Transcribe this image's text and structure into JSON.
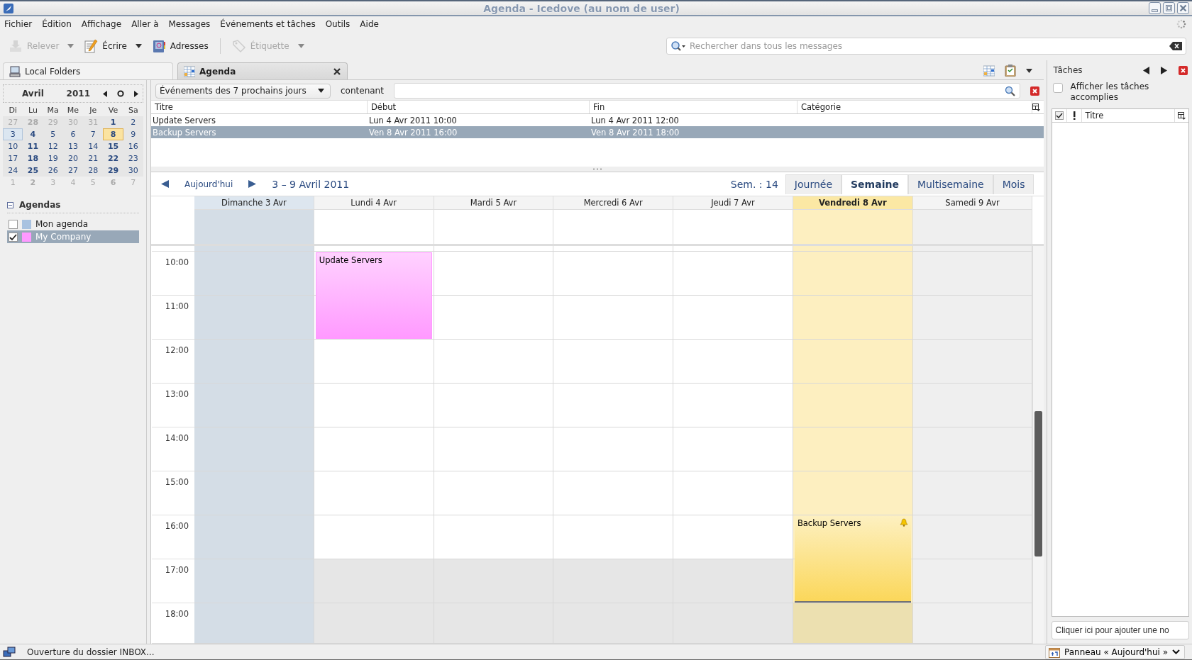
{
  "window": {
    "title": "Agenda - Icedove (au nom de user)"
  },
  "menu": [
    "Fichier",
    "Édition",
    "Affichage",
    "Aller à",
    "Messages",
    "Événements et tâches",
    "Outils",
    "Aide"
  ],
  "toolbar": {
    "buttons": [
      {
        "label": "Relever",
        "kind": "get",
        "disabled": true,
        "dropdown": true
      },
      {
        "label": "Écrire",
        "kind": "write",
        "disabled": false,
        "dropdown": true
      },
      {
        "label": "Adresses",
        "kind": "addressbook",
        "disabled": false,
        "dropdown": false
      },
      {
        "label": "Étiquette",
        "kind": "tag",
        "disabled": true,
        "dropdown": true
      }
    ],
    "search": {
      "placeholder": "Rechercher dans tous les messages"
    }
  },
  "tabs": [
    {
      "label": "Local Folders",
      "kind": "folders",
      "selected": false,
      "closable": false
    },
    {
      "label": "Agenda",
      "kind": "calendar",
      "selected": true,
      "closable": true
    }
  ],
  "minimonth": {
    "month": "Avril",
    "year": "2011",
    "weekdays": [
      "Di",
      "Lu",
      "Ma",
      "Me",
      "Je",
      "Ve",
      "Sa"
    ],
    "weeks": [
      [
        {
          "day": "27",
          "muted": true,
          "bold": false,
          "selected": false,
          "today": false
        },
        {
          "day": "28",
          "muted": true,
          "bold": true,
          "selected": false,
          "today": false
        },
        {
          "day": "29",
          "muted": true,
          "bold": false,
          "selected": false,
          "today": false
        },
        {
          "day": "30",
          "muted": true,
          "bold": false,
          "selected": false,
          "today": false
        },
        {
          "day": "31",
          "muted": true,
          "bold": false,
          "selected": false,
          "today": false
        },
        {
          "day": "1",
          "muted": false,
          "bold": true,
          "selected": false,
          "today": false
        },
        {
          "day": "2",
          "muted": false,
          "bold": false,
          "selected": false,
          "today": false
        }
      ],
      [
        {
          "day": "3",
          "muted": false,
          "bold": false,
          "selected": true,
          "today": false
        },
        {
          "day": "4",
          "muted": false,
          "bold": true,
          "selected": false,
          "today": false
        },
        {
          "day": "5",
          "muted": false,
          "bold": false,
          "selected": false,
          "today": false
        },
        {
          "day": "6",
          "muted": false,
          "bold": false,
          "selected": false,
          "today": false
        },
        {
          "day": "7",
          "muted": false,
          "bold": false,
          "selected": false,
          "today": false
        },
        {
          "day": "8",
          "muted": false,
          "bold": true,
          "selected": false,
          "today": true
        },
        {
          "day": "9",
          "muted": false,
          "bold": false,
          "selected": false,
          "today": false
        }
      ],
      [
        {
          "day": "10",
          "muted": false,
          "bold": false,
          "selected": false,
          "today": false
        },
        {
          "day": "11",
          "muted": false,
          "bold": true,
          "selected": false,
          "today": false
        },
        {
          "day": "12",
          "muted": false,
          "bold": false,
          "selected": false,
          "today": false
        },
        {
          "day": "13",
          "muted": false,
          "bold": false,
          "selected": false,
          "today": false
        },
        {
          "day": "14",
          "muted": false,
          "bold": false,
          "selected": false,
          "today": false
        },
        {
          "day": "15",
          "muted": false,
          "bold": true,
          "selected": false,
          "today": false
        },
        {
          "day": "16",
          "muted": false,
          "bold": false,
          "selected": false,
          "today": false
        }
      ],
      [
        {
          "day": "17",
          "muted": false,
          "bold": false,
          "selected": false,
          "today": false
        },
        {
          "day": "18",
          "muted": false,
          "bold": true,
          "selected": false,
          "today": false
        },
        {
          "day": "19",
          "muted": false,
          "bold": false,
          "selected": false,
          "today": false
        },
        {
          "day": "20",
          "muted": false,
          "bold": false,
          "selected": false,
          "today": false
        },
        {
          "day": "21",
          "muted": false,
          "bold": false,
          "selected": false,
          "today": false
        },
        {
          "day": "22",
          "muted": false,
          "bold": true,
          "selected": false,
          "today": false
        },
        {
          "day": "23",
          "muted": false,
          "bold": false,
          "selected": false,
          "today": false
        }
      ],
      [
        {
          "day": "24",
          "muted": false,
          "bold": false,
          "selected": false,
          "today": false
        },
        {
          "day": "25",
          "muted": false,
          "bold": true,
          "selected": false,
          "today": false
        },
        {
          "day": "26",
          "muted": false,
          "bold": false,
          "selected": false,
          "today": false
        },
        {
          "day": "27",
          "muted": false,
          "bold": false,
          "selected": false,
          "today": false
        },
        {
          "day": "28",
          "muted": false,
          "bold": false,
          "selected": false,
          "today": false
        },
        {
          "day": "29",
          "muted": false,
          "bold": true,
          "selected": false,
          "today": false
        },
        {
          "day": "30",
          "muted": false,
          "bold": false,
          "selected": false,
          "today": false
        }
      ],
      [
        {
          "day": "1",
          "muted": true,
          "bold": false,
          "selected": false,
          "today": false
        },
        {
          "day": "2",
          "muted": true,
          "bold": true,
          "selected": false,
          "today": false
        },
        {
          "day": "3",
          "muted": true,
          "bold": false,
          "selected": false,
          "today": false
        },
        {
          "day": "4",
          "muted": true,
          "bold": false,
          "selected": false,
          "today": false
        },
        {
          "day": "5",
          "muted": true,
          "bold": false,
          "selected": false,
          "today": false
        },
        {
          "day": "6",
          "muted": true,
          "bold": true,
          "selected": false,
          "today": false
        },
        {
          "day": "7",
          "muted": true,
          "bold": false,
          "selected": false,
          "today": false
        }
      ]
    ]
  },
  "calendars": {
    "title": "Agendas",
    "expanded": true,
    "items": [
      {
        "name": "Mon agenda",
        "color": "#a8c2e0",
        "checked": false,
        "selected": false
      },
      {
        "name": "My Company",
        "color": "#ff99ff",
        "checked": true,
        "selected": true
      }
    ]
  },
  "event_list": {
    "filter": "Événements des 7 prochains jours",
    "search_label": "contenant",
    "columns": [
      "Titre",
      "Début",
      "Fin",
      "Catégorie"
    ],
    "rows": [
      {
        "title": "Update Servers",
        "start": "Lun 4 Avr 2011 10:00",
        "end": "Lun 4 Avr 2011 12:00",
        "selected": false
      },
      {
        "title": "Backup Servers",
        "start": "Ven 8 Avr 2011 16:00",
        "end": "Ven 8 Avr 2011 18:00",
        "selected": true
      }
    ]
  },
  "week_view": {
    "today_button": "Aujourd'hui",
    "range": "3 – 9 Avril 2011",
    "week_number": "Sem. : 14",
    "views": [
      {
        "label": "Journée",
        "selected": false
      },
      {
        "label": "Semaine",
        "selected": true
      },
      {
        "label": "Multisemaine",
        "selected": false
      },
      {
        "label": "Mois",
        "selected": false
      }
    ],
    "days": [
      {
        "label": "Dimanche 3 Avr",
        "kind": "selected"
      },
      {
        "label": "Lundi 4 Avr",
        "kind": "normal",
        "cells": [
          {
            "off_hours": false,
            "event": {
              "title": "Update Servers",
              "color": "#ff99ff",
              "selected": false,
              "alarm": false
            }
          },
          {
            "covered": true
          },
          {
            "off_hours": false
          },
          {
            "off_hours": false
          },
          {
            "off_hours": false
          },
          {
            "off_hours": false
          },
          {
            "off_hours": false
          },
          {
            "off_hours": true
          },
          {
            "off_hours": true
          }
        ]
      },
      {
        "label": "Mardi 5 Avr",
        "kind": "normal",
        "cells": [
          {
            "off_hours": false
          },
          {
            "off_hours": false
          },
          {
            "off_hours": false
          },
          {
            "off_hours": false
          },
          {
            "off_hours": false
          },
          {
            "off_hours": false
          },
          {
            "off_hours": false
          },
          {
            "off_hours": true
          },
          {
            "off_hours": true
          }
        ]
      },
      {
        "label": "Mercredi 6 Avr",
        "kind": "normal",
        "cells": [
          {
            "off_hours": false
          },
          {
            "off_hours": false
          },
          {
            "off_hours": false
          },
          {
            "off_hours": false
          },
          {
            "off_hours": false
          },
          {
            "off_hours": false
          },
          {
            "off_hours": false
          },
          {
            "off_hours": true
          },
          {
            "off_hours": true
          }
        ]
      },
      {
        "label": "Jeudi 7 Avr",
        "kind": "normal",
        "cells": [
          {
            "off_hours": false
          },
          {
            "off_hours": false
          },
          {
            "off_hours": false
          },
          {
            "off_hours": false
          },
          {
            "off_hours": false
          },
          {
            "off_hours": false
          },
          {
            "off_hours": false
          },
          {
            "off_hours": true
          },
          {
            "off_hours": true
          }
        ]
      },
      {
        "label": "Vendredi 8 Avr",
        "kind": "today",
        "cells": [
          {
            "off_hours": false
          },
          {
            "off_hours": false
          },
          {
            "off_hours": false
          },
          {
            "off_hours": false
          },
          {
            "off_hours": false
          },
          {
            "off_hours": false
          },
          {
            "off_hours": false,
            "event": {
              "title": "Backup Servers",
              "selected": true,
              "alarm": true
            }
          },
          {
            "covered": true
          },
          {
            "off_hours": true
          }
        ]
      },
      {
        "label": "Samedi 9 Avr",
        "kind": "weekend"
      }
    ],
    "hours": [
      {
        "label": "10:00"
      },
      {
        "label": "11:00"
      },
      {
        "label": "12:00"
      },
      {
        "label": "13:00"
      },
      {
        "label": "14:00"
      },
      {
        "label": "15:00"
      },
      {
        "label": "16:00"
      },
      {
        "label": "17:00"
      },
      {
        "label": "18:00"
      }
    ]
  },
  "tasks": {
    "title": "Tâches",
    "show_completed": {
      "label": "Afficher les tâches accomplies",
      "checked": false
    },
    "columns": [
      "Titre"
    ],
    "new_task": {
      "placeholder": "Cliquer ici pour ajouter une no"
    }
  },
  "status_bar": {
    "message": "Ouverture du dossier INBOX...",
    "today_pane": "Panneau « Aujourd'hui »"
  }
}
